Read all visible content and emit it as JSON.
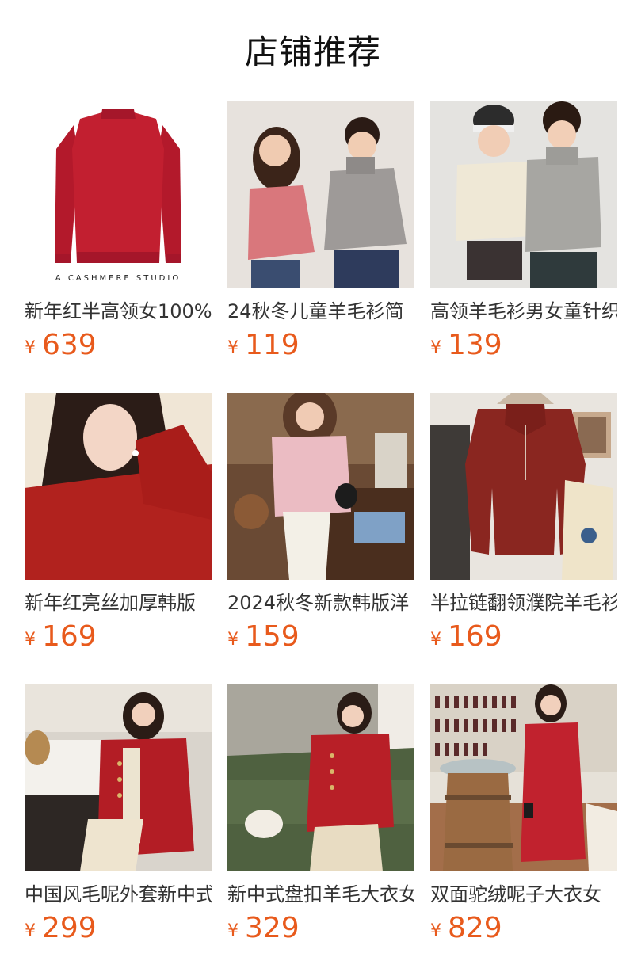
{
  "header": {
    "title": "店铺推荐"
  },
  "products": [
    {
      "title": "新年红半高领女100%",
      "currency": "¥",
      "price": "639",
      "brand_text": "A CASHMERE STUDIO"
    },
    {
      "title": "24秋冬儿童羊毛衫简",
      "currency": "¥",
      "price": "119"
    },
    {
      "title": "高领羊毛衫男女童针织",
      "currency": "¥",
      "price": "139"
    },
    {
      "title": "新年红亮丝加厚韩版",
      "currency": "¥",
      "price": "169"
    },
    {
      "title": "2024秋冬新款韩版洋",
      "currency": "¥",
      "price": "159"
    },
    {
      "title": "半拉链翻领濮院羊毛衫",
      "currency": "¥",
      "price": "169"
    },
    {
      "title": "中国风毛呢外套新中式",
      "currency": "¥",
      "price": "299"
    },
    {
      "title": "新中式盘扣羊毛大衣女",
      "currency": "¥",
      "price": "329"
    },
    {
      "title": "双面驼绒呢子大衣女",
      "currency": "¥",
      "price": "829"
    }
  ],
  "colors": {
    "price": "#e85a1c",
    "title_text": "#333333",
    "header_text": "#111111"
  }
}
